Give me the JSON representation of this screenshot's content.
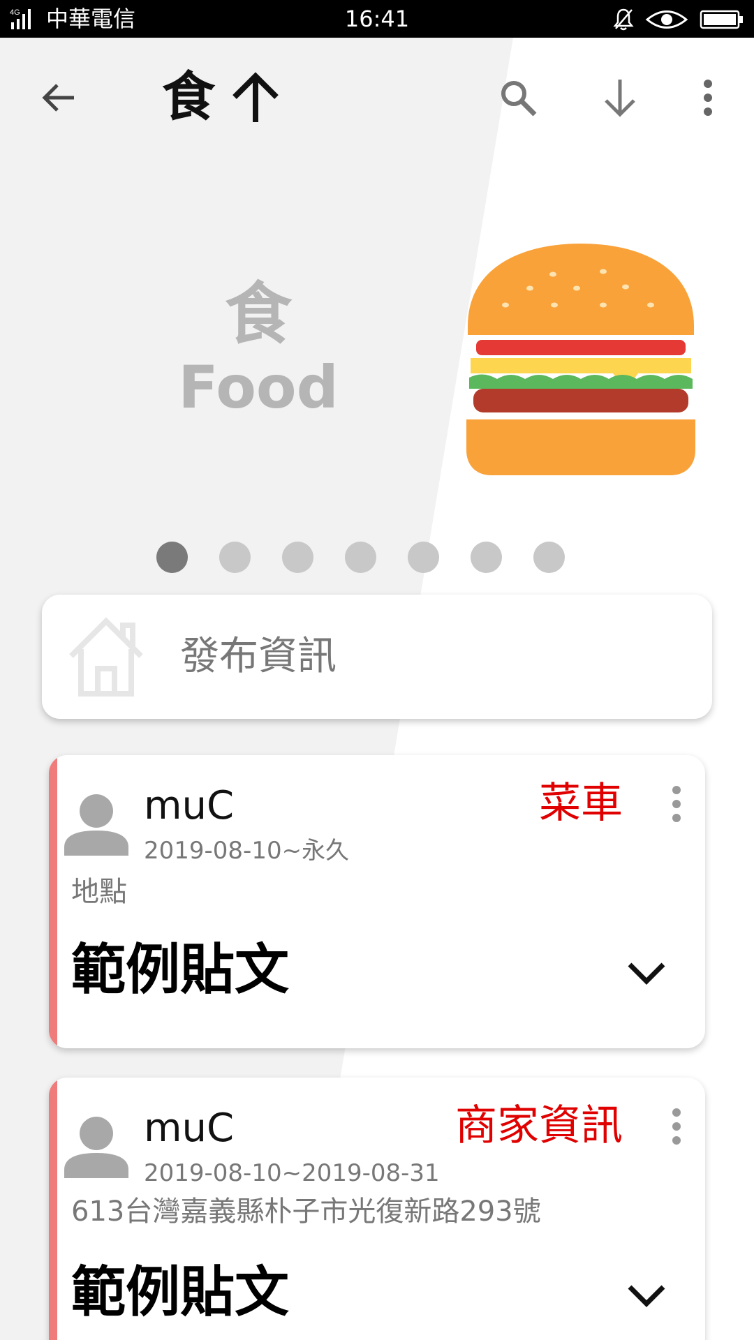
{
  "status_bar": {
    "network": "4G",
    "carrier": "中華電信",
    "time": "16:41",
    "icons": [
      "signal-icon",
      "mute-bell-icon",
      "eye-comfort-icon",
      "battery-icon"
    ]
  },
  "app_bar": {
    "title": "食",
    "icons": [
      "back-arrow-icon",
      "arrow-up-icon",
      "search-icon",
      "download-arrow-icon",
      "more-vert-icon"
    ]
  },
  "hero": {
    "label_zh": "食",
    "label_en": "Food",
    "image_icon": "burger-icon",
    "page_count": 7,
    "active_page": 1
  },
  "post_box": {
    "icon": "home-icon",
    "placeholder": "發布資訊"
  },
  "posts": [
    {
      "user": "muC",
      "date_range": "2019-08-10~永久",
      "location": "地點",
      "tag": "菜車",
      "title": "範例貼文"
    },
    {
      "user": "muC",
      "date_range": "2019-08-10~2019-08-31",
      "location": "613台灣嘉義縣朴子市光復新路293號",
      "tag": "商家資訊",
      "title": "範例貼文"
    }
  ],
  "colors": {
    "accent_bar": "#ef7b7b",
    "tag_red": "#e00000",
    "hero_bg": "#f2f2f2",
    "dot_active": "#7a7a7a",
    "dot_inactive": "#c8c8c8"
  }
}
